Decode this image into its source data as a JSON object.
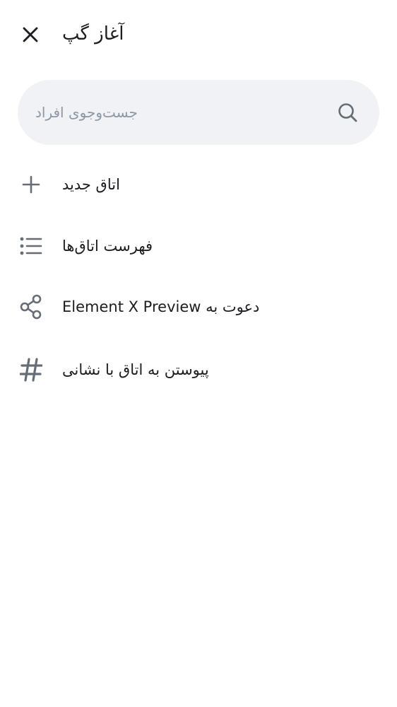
{
  "header": {
    "title": "آغاز گپ",
    "close_icon": "close-icon"
  },
  "search": {
    "placeholder": "جست‌وجوی افراد",
    "value": "",
    "icon": "search-icon"
  },
  "menu": {
    "items": [
      {
        "label": "اتاق جدید",
        "icon": "plus-icon"
      },
      {
        "label": "فهرست اتاق‌ها",
        "icon": "list-icon"
      },
      {
        "label": "دعوت به Element X Preview",
        "icon": "share-icon"
      },
      {
        "label": "پیوستن به اتاق با نشانی",
        "icon": "hash-icon"
      }
    ]
  },
  "colors": {
    "icon": "#656d77",
    "text": "#1b1d22",
    "search_bg": "#f0f2f5",
    "placeholder": "#8d97a5"
  }
}
